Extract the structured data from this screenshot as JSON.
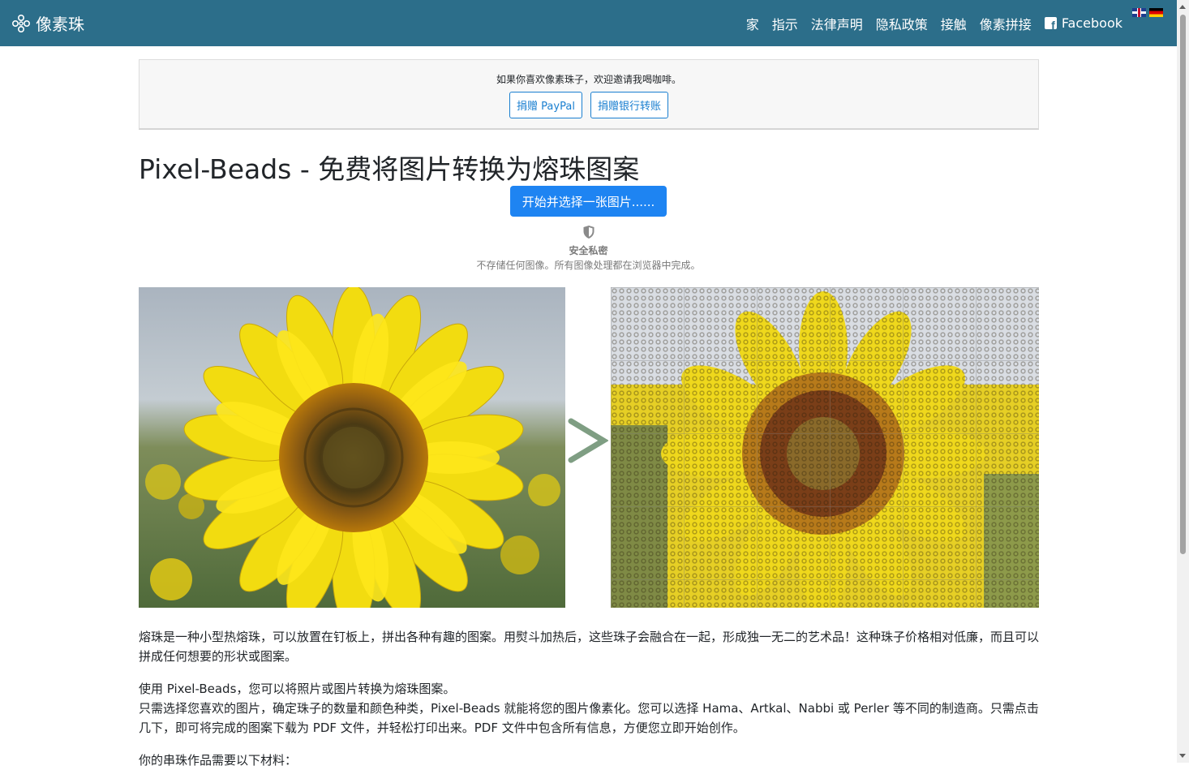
{
  "navbar": {
    "brand": "像素珠",
    "links": [
      "家",
      "指示",
      "法律声明",
      "隐私政策",
      "接触",
      "像素拼接"
    ],
    "facebook": "Facebook",
    "bg_color": "#2c6e8a"
  },
  "donate": {
    "text": "如果你喜欢像素珠子，欢迎邀请我喝咖啡。",
    "paypal": "捐赠 PayPal",
    "bank": "捐赠银行转账"
  },
  "main": {
    "title": "Pixel-Beads - 免费将图片转换为熔珠图案",
    "start_button": "开始并选择一张图片......",
    "secure_title": "安全私密",
    "secure_desc": "不存储任何图像。所有图像处理都在浏览器中完成。",
    "paragraph1": "熔珠是一种小型热熔珠，可以放置在钉板上，拼出各种有趣的图案。用熨斗加热后，这些珠子会融合在一起，形成独一无二的艺术品！这种珠子价格相对低廉，而且可以拼成任何想要的形状或图案。",
    "paragraph2a": "使用 Pixel-Beads，您可以将照片或图片转换为熔珠图案。",
    "paragraph2b": "只需选择您喜欢的图片，确定珠子的数量和颜色种类，Pixel-Beads 就能将您的图片像素化。您可以选择 Hama、Artkal、Nabbi 或 Perler 等不同的制造商。只需点击几下，即可将完成的图案下载为 PDF 文件，并轻松打印出来。PDF 文件中包含所有信息，方便您立即开始创作。",
    "paragraph3": "你的串珠作品需要以下材料："
  },
  "colors": {
    "primary": "#1e84f2",
    "outline": "#1a7fd0"
  }
}
